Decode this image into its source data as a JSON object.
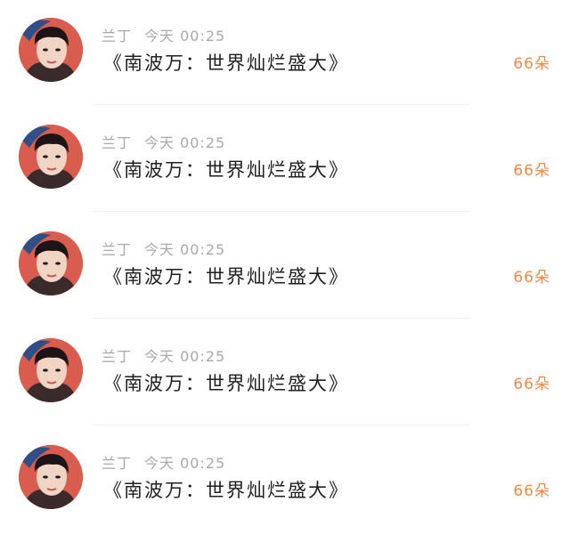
{
  "messages": [
    {
      "sender": "兰丁",
      "time": "今天 00:25",
      "title": "《南波万：世界灿烂盛大》",
      "count": "66朵",
      "avatar_icon": "user-avatar-photo"
    },
    {
      "sender": "兰丁",
      "time": "今天 00:25",
      "title": "《南波万：世界灿烂盛大》",
      "count": "66朵",
      "avatar_icon": "user-avatar-photo"
    },
    {
      "sender": "兰丁",
      "time": "今天 00:25",
      "title": "《南波万：世界灿烂盛大》",
      "count": "66朵",
      "avatar_icon": "user-avatar-photo"
    },
    {
      "sender": "兰丁",
      "time": "今天 00:25",
      "title": "《南波万：世界灿烂盛大》",
      "count": "66朵",
      "avatar_icon": "user-avatar-photo"
    },
    {
      "sender": "兰丁",
      "time": "今天 00:25",
      "title": "《南波万：世界灿烂盛大》",
      "count": "66朵",
      "avatar_icon": "user-avatar-photo"
    }
  ],
  "colors": {
    "count_accent": "#f08a4b",
    "meta_gray": "#a9a9a9",
    "title_text": "#1f1f1f",
    "avatar_ring": "#2f4f86",
    "avatar_bg": "#d95c4e"
  }
}
